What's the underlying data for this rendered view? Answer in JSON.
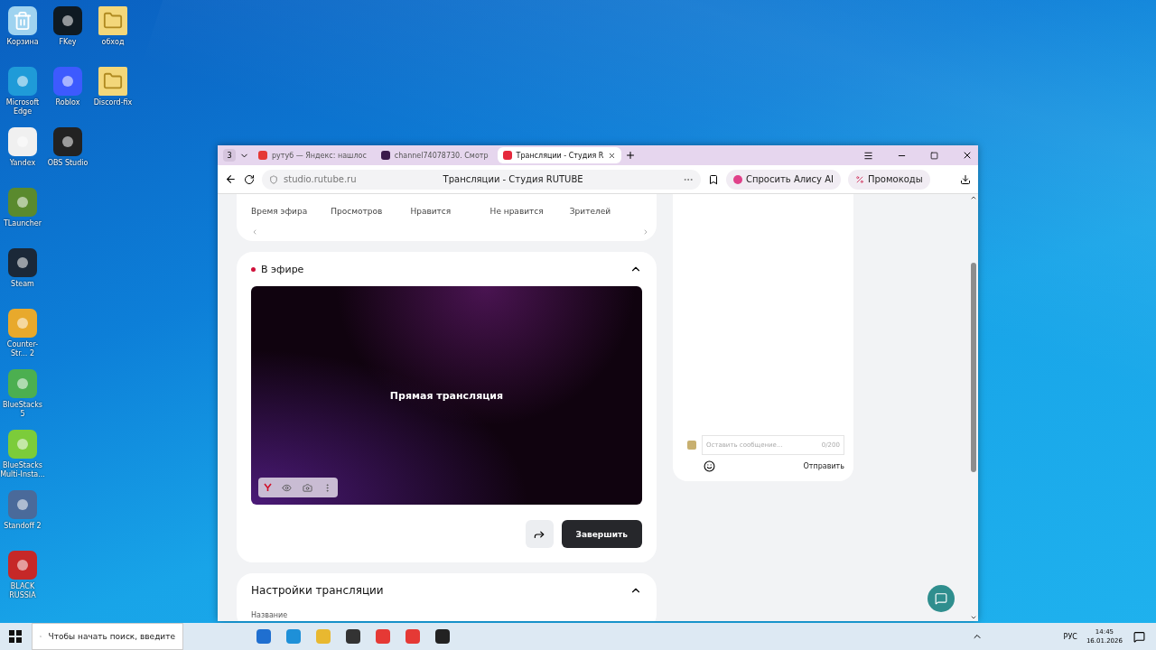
{
  "desktop": {
    "columns": [
      {
        "icons": [
          {
            "label": "Корзина",
            "kind": "bin",
            "color": "#9fd3f0"
          },
          {
            "label": "Microsoft Edge",
            "kind": "app",
            "color": "#1f9bd8"
          },
          {
            "label": "Yandex",
            "kind": "app",
            "color": "#f0f0f0"
          },
          {
            "label": "TLauncher",
            "kind": "app",
            "color": "#5a8a2e"
          },
          {
            "label": "Steam",
            "kind": "app",
            "color": "#1b2838"
          },
          {
            "label": "Counter-Str... 2",
            "kind": "app",
            "color": "#e8a92c"
          },
          {
            "label": "BlueStacks 5",
            "kind": "app",
            "color": "#4caf50"
          },
          {
            "label": "BlueStacks Multi-Insta...",
            "kind": "app",
            "color": "#7ccc3a"
          },
          {
            "label": "Standoff 2",
            "kind": "app",
            "color": "#4a6a9a"
          },
          {
            "label": "BLACK RUSSIA",
            "kind": "app",
            "color": "#c62828"
          }
        ]
      },
      {
        "icons": [
          {
            "label": "FKey",
            "kind": "app",
            "color": "#0f1a22"
          },
          {
            "label": "Roblox",
            "kind": "app",
            "color": "#3d5afe"
          },
          {
            "label": "OBS Studio",
            "kind": "app",
            "color": "#222222"
          }
        ]
      },
      {
        "icons": [
          {
            "label": "обход",
            "kind": "folder",
            "color": "#f3d77a"
          },
          {
            "label": "Discord-fix",
            "kind": "folder",
            "color": "#f3d77a"
          }
        ]
      }
    ]
  },
  "browser": {
    "tab_count": "3",
    "tabs": [
      {
        "title": "рутуб — Яндекс: нашлос",
        "selected": false,
        "color": "#e53935"
      },
      {
        "title": "channel74078730. Смотр",
        "selected": false,
        "color": "#3a1a4a"
      },
      {
        "title": "Трансляции - Студия R",
        "selected": true,
        "color": "#e5283c"
      }
    ],
    "address": "studio.rutube.ru",
    "page_title": "Трансляции - Студия RUTUBE",
    "alice_button": "Спросить Алису AI",
    "promo_button": "Промокоды"
  },
  "stats": [
    {
      "label": "Время эфира"
    },
    {
      "label": "Просмотров"
    },
    {
      "label": "Нравится"
    },
    {
      "label": "Не нравится"
    },
    {
      "label": "Зрителей"
    }
  ],
  "live": {
    "title": "В эфире",
    "expanded": true,
    "video_text": "Прямая трансляция",
    "finish_button": "Завершить"
  },
  "settings": {
    "title": "Настройки трансляции",
    "expanded": true,
    "field_label": "Название"
  },
  "chat": {
    "placeholder": "Оставить сообщение...",
    "counter": "0/200",
    "send_button": "Отправить"
  },
  "taskbar": {
    "search_placeholder": "Чтобы начать поиск, введите",
    "language": "РУС",
    "time": "14:45",
    "date": "16.01.2026"
  }
}
